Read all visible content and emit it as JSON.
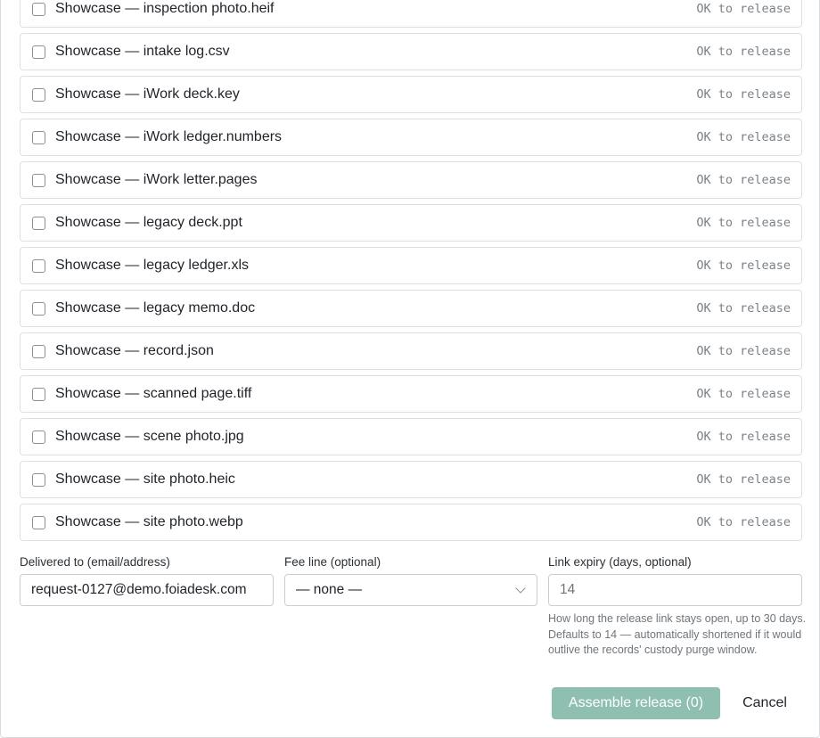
{
  "records": [
    {
      "title": "Showcase — inspection photo.heif",
      "status": "OK to release"
    },
    {
      "title": "Showcase — intake log.csv",
      "status": "OK to release"
    },
    {
      "title": "Showcase — iWork deck.key",
      "status": "OK to release"
    },
    {
      "title": "Showcase — iWork ledger.numbers",
      "status": "OK to release"
    },
    {
      "title": "Showcase — iWork letter.pages",
      "status": "OK to release"
    },
    {
      "title": "Showcase — legacy deck.ppt",
      "status": "OK to release"
    },
    {
      "title": "Showcase — legacy ledger.xls",
      "status": "OK to release"
    },
    {
      "title": "Showcase — legacy memo.doc",
      "status": "OK to release"
    },
    {
      "title": "Showcase — record.json",
      "status": "OK to release"
    },
    {
      "title": "Showcase — scanned page.tiff",
      "status": "OK to release"
    },
    {
      "title": "Showcase — scene photo.jpg",
      "status": "OK to release"
    },
    {
      "title": "Showcase — site photo.heic",
      "status": "OK to release"
    },
    {
      "title": "Showcase — site photo.webp",
      "status": "OK to release"
    }
  ],
  "form": {
    "delivered_to": {
      "label": "Delivered to (email/address)",
      "value": "request-0127@demo.foiadesk.com"
    },
    "fee_line": {
      "label": "Fee line (optional)",
      "selected": "— none —"
    },
    "link_expiry": {
      "label": "Link expiry (days, optional)",
      "placeholder": "14",
      "help": "How long the release link stays open, up to 30 days. Defaults to 14 — automatically shortened if it would outlive the records' custody purge window."
    }
  },
  "actions": {
    "assemble_label": "Assemble release (0)",
    "cancel_label": "Cancel"
  },
  "colors": {
    "primary_disabled": "#8fbfb1",
    "status_text": "#7a8087",
    "border": "#dcdfe3"
  }
}
